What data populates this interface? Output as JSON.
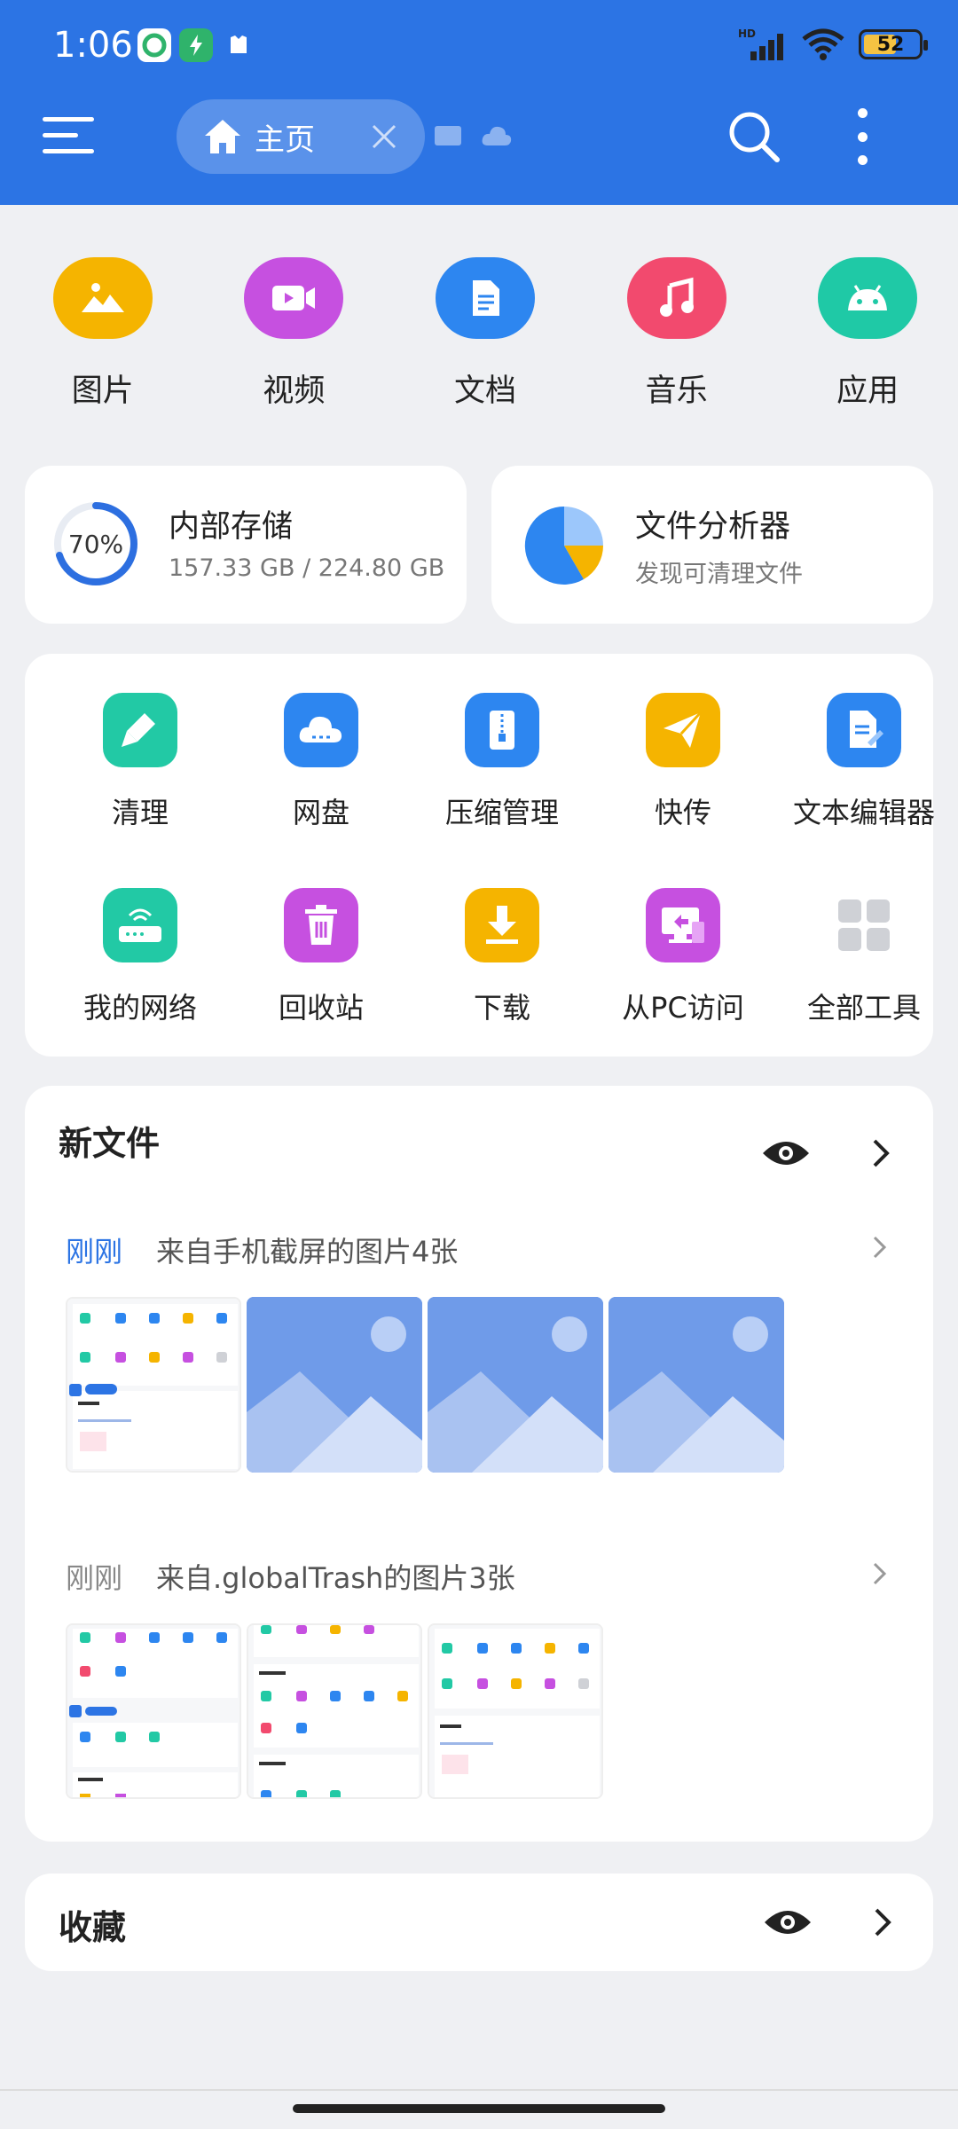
{
  "status": {
    "time": "1:06",
    "battery": "52",
    "network": "HD"
  },
  "header": {
    "tab_label": "主页"
  },
  "categories": [
    {
      "label": "图片",
      "icon": "image-icon",
      "color": "#f5b400"
    },
    {
      "label": "视频",
      "icon": "video-icon",
      "color": "#c650e0"
    },
    {
      "label": "文档",
      "icon": "document-icon",
      "color": "#2d86f0"
    },
    {
      "label": "音乐",
      "icon": "music-icon",
      "color": "#f24a6e"
    },
    {
      "label": "应用",
      "icon": "android-icon",
      "color": "#1fc9a6"
    }
  ],
  "storage": {
    "title": "内部存储",
    "usage": "157.33 GB / 224.80 GB",
    "percent_label": "70%",
    "percent": 70
  },
  "analyzer": {
    "title": "文件分析器",
    "subtitle": "发现可清理文件"
  },
  "tools": [
    {
      "label": "清理",
      "icon": "broom-icon",
      "color": "#22c9a5"
    },
    {
      "label": "网盘",
      "icon": "cloud-drive-icon",
      "color": "#2d86f0"
    },
    {
      "label": "压缩管理",
      "icon": "zip-icon",
      "color": "#2d86f0"
    },
    {
      "label": "快传",
      "icon": "send-icon",
      "color": "#f5b400"
    },
    {
      "label": "文本编辑器",
      "icon": "text-editor-icon",
      "color": "#2d86f0"
    },
    {
      "label": "我的网络",
      "icon": "router-icon",
      "color": "#22c9a5"
    },
    {
      "label": "回收站",
      "icon": "trash-icon",
      "color": "#c650e0"
    },
    {
      "label": "下载",
      "icon": "download-icon",
      "color": "#f5b400"
    },
    {
      "label": "从PC访问",
      "icon": "pc-access-icon",
      "color": "#c650e0"
    },
    {
      "label": "全部工具",
      "icon": "all-tools-icon",
      "color": "#cfd1d6"
    }
  ],
  "new_files": {
    "title": "新文件",
    "groups": [
      {
        "time": "刚刚",
        "text": "来自手机截屏的图片4张",
        "time_color": "#2c74e4"
      },
      {
        "time": "刚刚",
        "text": "来自.globalTrash的图片3张",
        "time_color": "#888888"
      }
    ]
  },
  "favorites": {
    "title": "收藏"
  },
  "colors": {
    "accent": "#2c74e4",
    "background": "#eff0f3"
  }
}
